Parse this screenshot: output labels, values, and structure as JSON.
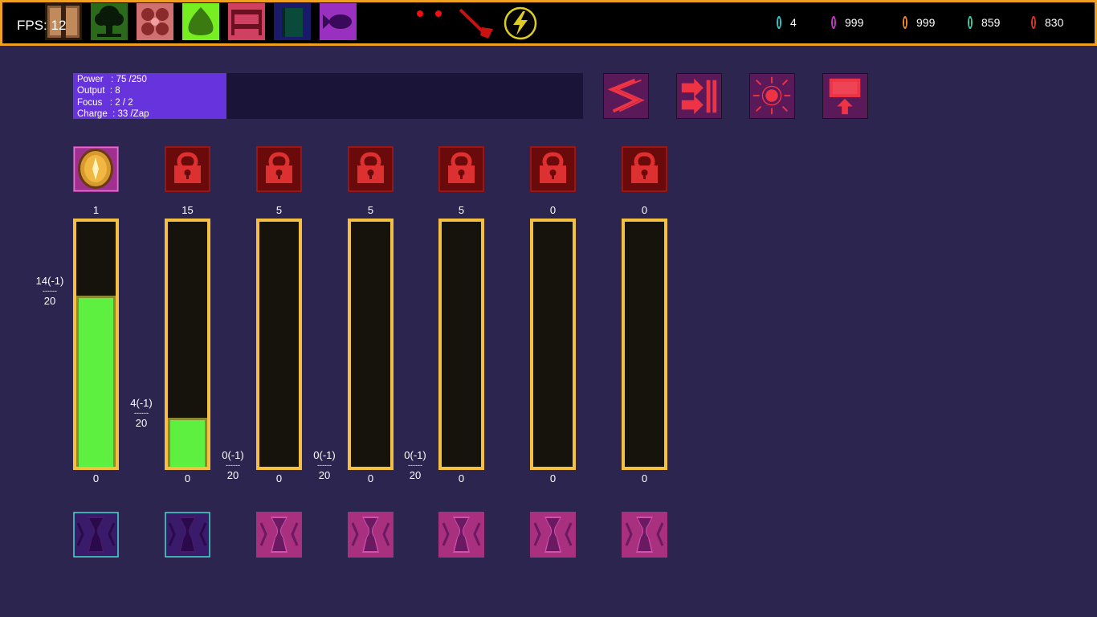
{
  "hud": {
    "fps_text": "FPS: 12",
    "tools": [
      {
        "name": "crate-icon",
        "bg": "#8a5a3a"
      },
      {
        "name": "tree-icon",
        "bg": "#2a5a1a"
      },
      {
        "name": "flower-icon",
        "bg": "#c05050"
      },
      {
        "name": "slime-icon",
        "bg": "#44bb22"
      },
      {
        "name": "bed-icon",
        "bg": "#b03050"
      },
      {
        "name": "book-icon",
        "bg": "#1a2a7a"
      },
      {
        "name": "fish-icon",
        "bg": "#7a2aa0"
      }
    ],
    "resources": [
      {
        "name": "cyan-gem",
        "value": "4",
        "color": "#22cccc"
      },
      {
        "name": "magenta-gem",
        "value": "999",
        "color": "#cc33cc"
      },
      {
        "name": "orange-gem",
        "value": "999",
        "color": "#ee8822"
      },
      {
        "name": "teal-gem",
        "value": "859",
        "color": "#33ccaa"
      },
      {
        "name": "red-gem",
        "value": "830",
        "color": "#dd3322"
      }
    ]
  },
  "power_panel": {
    "power_line": "Power   : 75 /250",
    "output_line": "Output  : 8",
    "focus_line": "Focus   : 2 / 2",
    "charge_line": "Charge  : 33 /Zap",
    "power_current": 75,
    "power_max": 250
  },
  "actions": [
    {
      "name": "lightning-action-icon"
    },
    {
      "name": "transfer-action-icon"
    },
    {
      "name": "burst-action-icon"
    },
    {
      "name": "upgrade-action-icon"
    }
  ],
  "slots": [
    {
      "icon": "coin-icon",
      "locked": false,
      "top": "1",
      "bottom": "0",
      "fill": 0.7,
      "label_top": "14(-1)",
      "label_div": "------",
      "label_bottom": "20",
      "rune_active": true
    },
    {
      "icon": "lock-icon",
      "locked": true,
      "top": "15",
      "bottom": "0",
      "fill": 0.2,
      "label_top": "4(-1)",
      "label_div": "------",
      "label_bottom": "20",
      "rune_active": true
    },
    {
      "icon": "lock-icon",
      "locked": true,
      "top": "5",
      "bottom": "0",
      "fill": 0.0,
      "label_top": "0(-1)",
      "label_div": "------",
      "label_bottom": "20",
      "rune_active": false
    },
    {
      "icon": "lock-icon",
      "locked": true,
      "top": "5",
      "bottom": "0",
      "fill": 0.0,
      "label_top": "0(-1)",
      "label_div": "------",
      "label_bottom": "20",
      "rune_active": false
    },
    {
      "icon": "lock-icon",
      "locked": true,
      "top": "5",
      "bottom": "0",
      "fill": 0.0,
      "label_top": "0(-1)",
      "label_div": "------",
      "label_bottom": "20",
      "rune_active": false
    },
    {
      "icon": "lock-icon",
      "locked": true,
      "top": "0",
      "bottom": "0",
      "fill": 0.0,
      "rune_active": false
    },
    {
      "icon": "lock-icon",
      "locked": true,
      "top": "0",
      "bottom": "0",
      "fill": 0.0,
      "rune_active": false
    }
  ],
  "colors": {
    "background": "#2c2550",
    "bar_border": "#f5c040",
    "bar_fill": "#5ef040",
    "lock_bg": "#6a0a0a",
    "lock_fg": "#dd3030",
    "rune_active": "#3a1a6a",
    "rune_inactive": "#a8307f"
  }
}
